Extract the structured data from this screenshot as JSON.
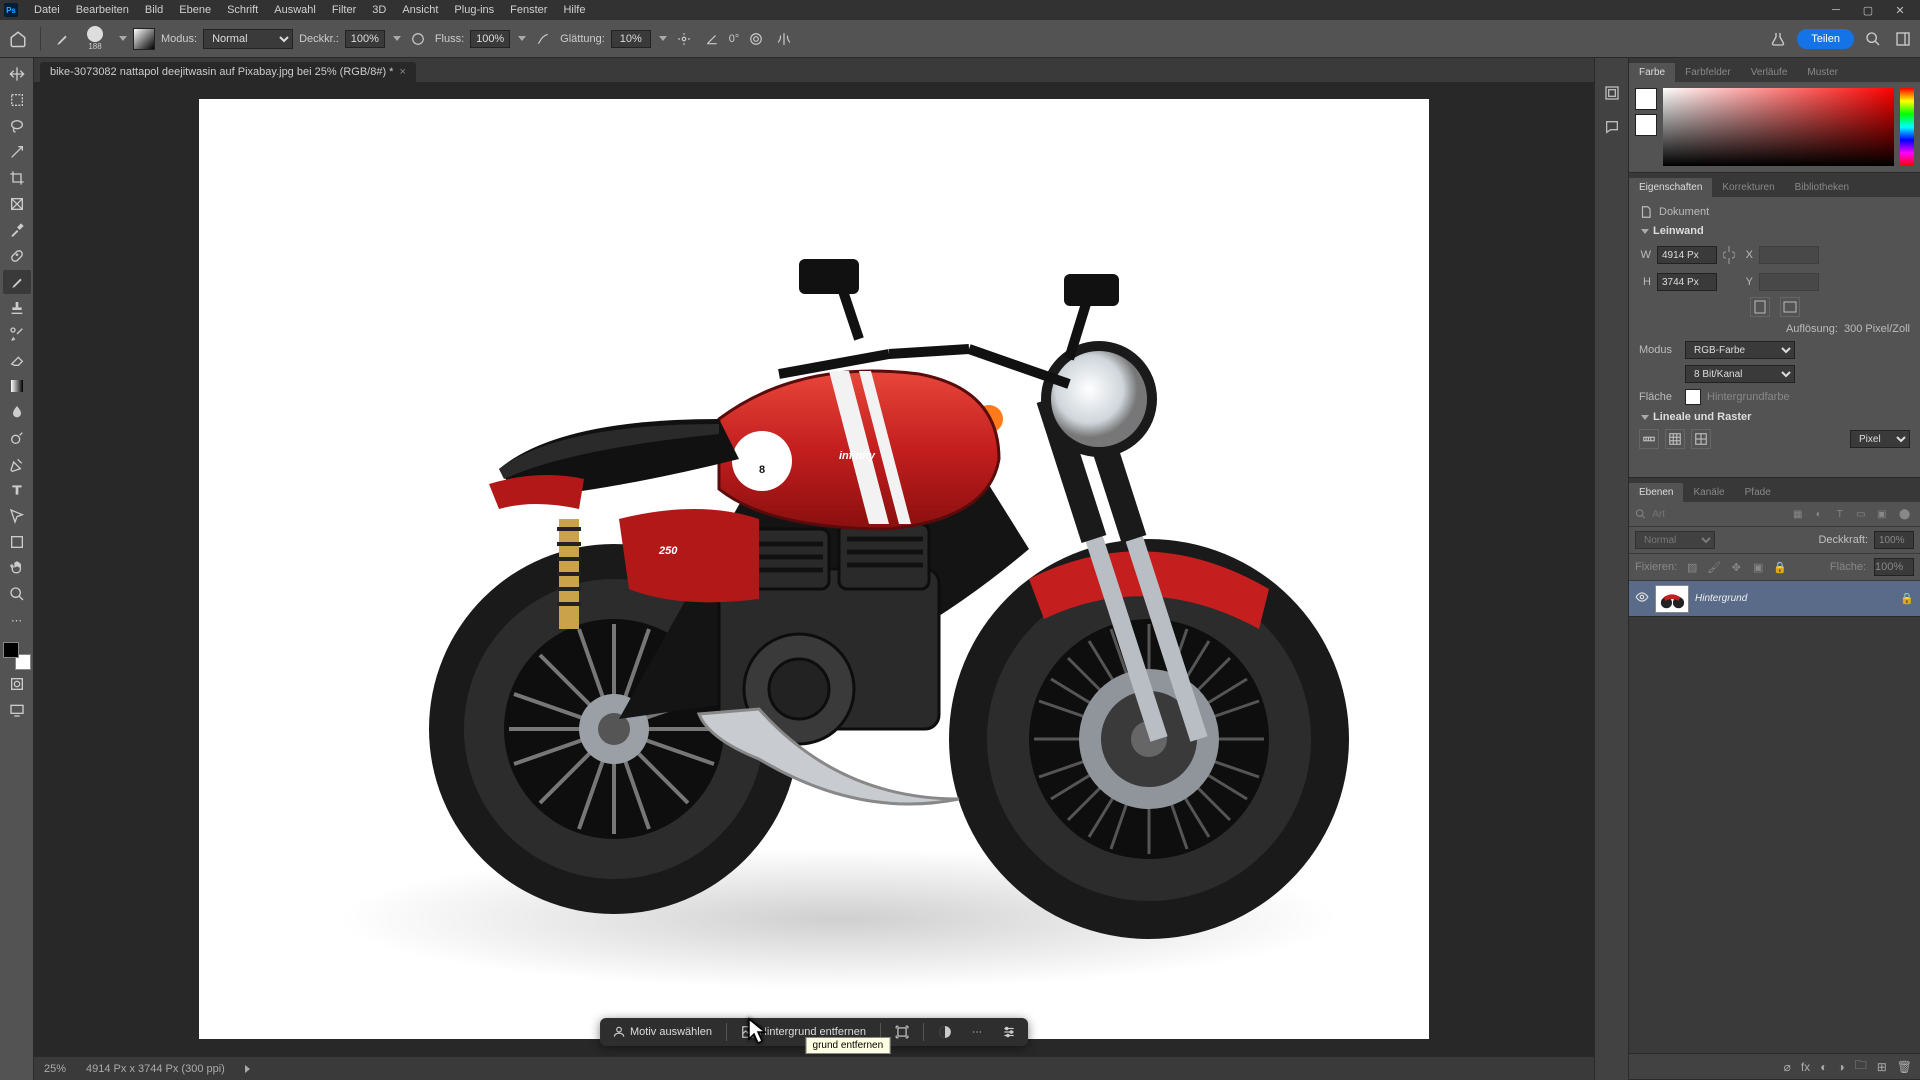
{
  "menubar": [
    "Datei",
    "Bearbeiten",
    "Bild",
    "Ebene",
    "Schrift",
    "Auswahl",
    "Filter",
    "3D",
    "Ansicht",
    "Plug-ins",
    "Fenster",
    "Hilfe"
  ],
  "optionsbar": {
    "brush_size": "188",
    "mode_label": "Modus:",
    "mode_value": "Normal",
    "opacity_label": "Deckkr.:",
    "opacity_value": "100%",
    "flow_label": "Fluss:",
    "flow_value": "100%",
    "smoothing_label": "Glättung:",
    "smoothing_value": "10%",
    "angle_value": "0°",
    "share_label": "Teilen"
  },
  "document_tab": {
    "title": "bike-3073082 nattapol deejitwasin auf Pixabay.jpg bei 25% (RGB/8#) *"
  },
  "context_bar": {
    "select_subject": "Motiv auswählen",
    "remove_bg": "Hintergrund entfernen",
    "tooltip": "grund entfernen"
  },
  "statusbar": {
    "zoom": "25%",
    "doc_info": "4914 Px x 3744 Px (300 ppi)"
  },
  "panel_color": {
    "tabs": [
      "Farbe",
      "Farbfelder",
      "Verläufe",
      "Muster"
    ],
    "fg": "#ffffff",
    "bg": "#ffffff"
  },
  "panel_props": {
    "tabs": [
      "Eigenschaften",
      "Korrekturen",
      "Bibliotheken"
    ],
    "doc_label": "Dokument",
    "canvas_section": "Leinwand",
    "w_label": "W",
    "w_value": "4914 Px",
    "h_label": "H",
    "h_value": "3744 Px",
    "x_label": "X",
    "y_label": "Y",
    "resolution_label": "Auflösung:",
    "resolution_value": "300 Pixel/Zoll",
    "mode_label": "Modus",
    "mode_value": "RGB-Farbe",
    "bit_value": "8 Bit/Kanal",
    "fill_label": "Fläche",
    "fill_value": "Hintergrundfarbe",
    "rulers_section": "Lineale und Raster",
    "ruler_select": "Pixel"
  },
  "panel_layers": {
    "tabs": [
      "Ebenen",
      "Kanäle",
      "Pfade"
    ],
    "filter_placeholder": "Art",
    "blend_value": "Normal",
    "opacity_label": "Deckkraft:",
    "opacity_value": "100%",
    "lock_label": "Fixieren:",
    "fill_label": "Fläche:",
    "fill_value": "100%",
    "layer_name": "Hintergrund"
  }
}
